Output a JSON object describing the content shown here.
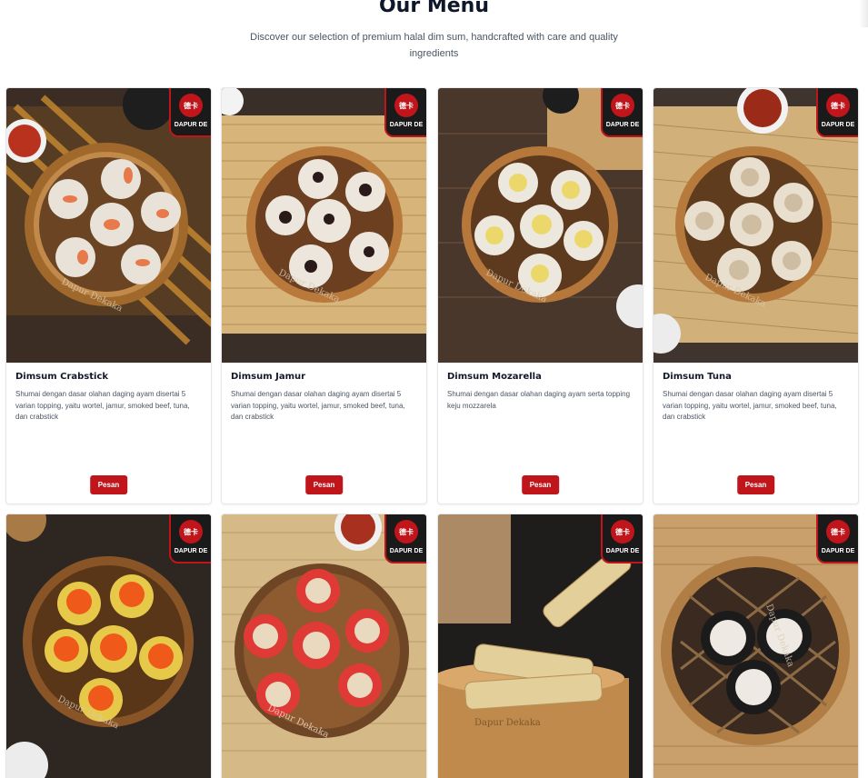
{
  "page": {
    "title": "Our Menu",
    "subtitle_line1": "Discover our selection of premium halal dim sum, handcrafted with care and quality",
    "subtitle_line2": "ingredients"
  },
  "brand": {
    "badge_text": "DAPUR DE",
    "seal_text": "德卡",
    "watermark": "Dapur Dekaka"
  },
  "colors": {
    "accent": "#c0151b",
    "badge_bg": "#1a1a1a"
  },
  "menu": [
    {
      "name": "Dimsum Crabstick",
      "desc": "Shumai dengan dasar olahan daging ayam disertai 5 varian topping, yaitu wortel, jamur, smoked beef, tuna, dan crabstick",
      "button": "Pesan",
      "topping": "crabstick"
    },
    {
      "name": "Dimsum Jamur",
      "desc": "Shumai dengan dasar olahan daging ayam disertai 5 varian topping, yaitu wortel, jamur, smoked beef, tuna, dan crabstick",
      "button": "Pesan",
      "topping": "jamur"
    },
    {
      "name": "Dimsum Mozarella",
      "desc": "Shumai dengan dasar olahan daging ayam serta topping keju mozzarela",
      "button": "Pesan",
      "topping": "mozarella"
    },
    {
      "name": "Dimsum Tuna",
      "desc": "Shumai dengan dasar olahan daging ayam disertai 5 varian topping, yaitu wortel, jamur, smoked beef, tuna, dan crabstick",
      "button": "Pesan",
      "topping": "tuna"
    },
    {
      "topping": "tobiko"
    },
    {
      "topping": "smoked-beef"
    },
    {
      "topping": "tofu-roll"
    },
    {
      "topping": "nori"
    }
  ]
}
